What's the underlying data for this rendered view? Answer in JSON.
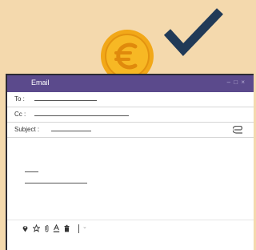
{
  "window": {
    "title": "Email",
    "controls": "– □ ×"
  },
  "fields": {
    "to_label": "To :",
    "cc_label": "Cc :",
    "subject_label": "Subject :"
  },
  "icons": {
    "coin": "euro-coin-icon",
    "check": "checkmark-icon",
    "attach": "paperclip-icon",
    "toolbar": [
      "location-pin-icon",
      "star-icon",
      "attach-icon",
      "text-color-icon",
      "trash-icon",
      "chevron-down-icon"
    ]
  },
  "colors": {
    "background": "#f4d9ad",
    "titlebar": "#5b4a8c",
    "coin": "#f2a818",
    "check": "#213a57"
  }
}
